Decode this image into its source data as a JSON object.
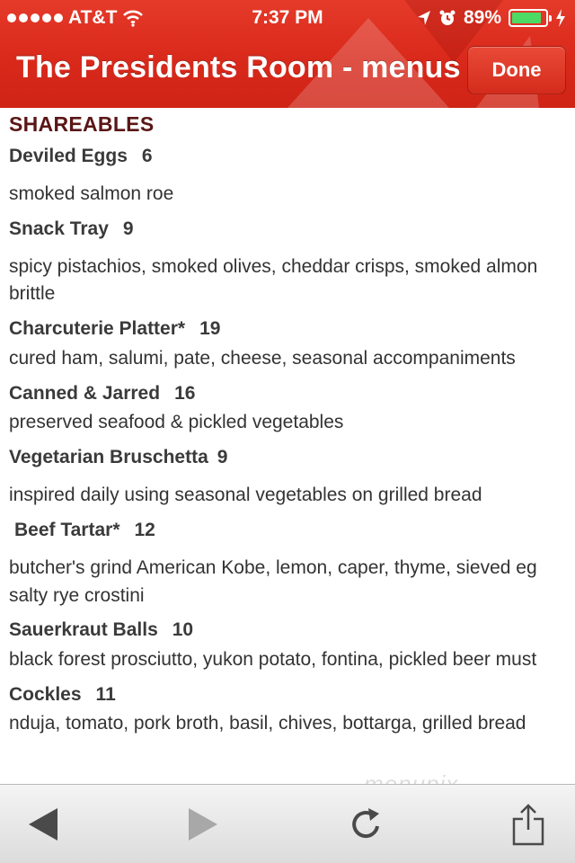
{
  "status_bar": {
    "carrier": "AT&T",
    "time": "7:37 PM",
    "battery_percent": "89%",
    "battery_level": 0.89
  },
  "nav": {
    "title": "The Presidents Room - menus",
    "done_label": "Done"
  },
  "menu": {
    "section_title": "SHAREABLES",
    "items": [
      {
        "name": "Deviled Eggs",
        "price": "6",
        "description": [
          "smoked salmon roe"
        ]
      },
      {
        "name": "Snack Tray",
        "price": "9",
        "description": [
          "spicy pistachios, smoked olives, cheddar crisps, smoked almon",
          "brittle"
        ]
      },
      {
        "name": "Charcuterie Platter*",
        "price": "19",
        "description": [
          "cured ham, salumi, pate, cheese, seasonal accompaniments"
        ]
      },
      {
        "name": "Canned & Jarred",
        "price": "16",
        "description": [
          "preserved seafood & pickled vegetables"
        ]
      },
      {
        "name": "Vegetarian Bruschetta",
        "price": "9",
        "description": [
          "inspired daily using seasonal vegetables on grilled bread"
        ]
      },
      {
        "name": "Beef Tartar*",
        "price": "12",
        "description": [
          "butcher's grind American Kobe, lemon, caper, thyme, sieved eg",
          "salty rye crostini"
        ]
      },
      {
        "name": "Sauerkraut Balls",
        "price": "10",
        "description": [
          "black forest prosciutto, yukon potato, fontina, pickled beer must"
        ]
      },
      {
        "name": "Cockles",
        "price": "11",
        "description": [
          "nduja, tomato, pork broth, basil, chives, bottarga, grilled bread"
        ]
      }
    ]
  },
  "watermark": "menupix",
  "toolbar": {
    "back_icon": "back-arrow-icon",
    "forward_icon": "forward-arrow-icon",
    "reload_icon": "reload-icon",
    "share_icon": "share-icon"
  },
  "colors": {
    "nav_red": "#d9291b",
    "section_title": "#5b1616",
    "battery_green": "#4cd964"
  }
}
